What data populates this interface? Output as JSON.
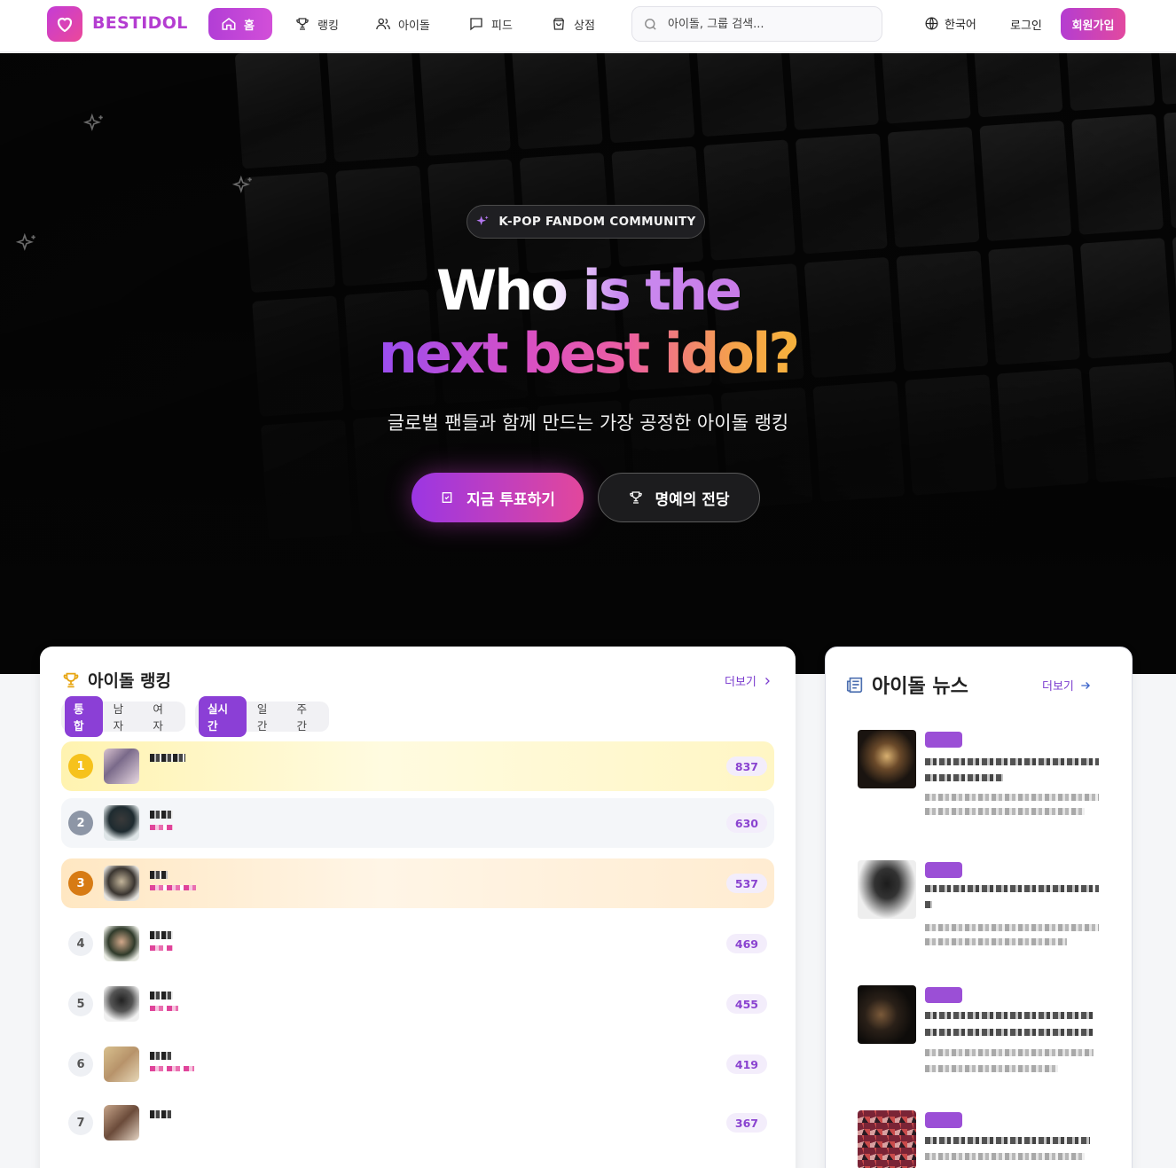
{
  "app": {
    "logo_text": "BESTIDOL",
    "brand_color": "#b43dd1"
  },
  "nav": {
    "items": [
      {
        "label": "홈",
        "icon": "home-icon",
        "active": true
      },
      {
        "label": "랭킹",
        "icon": "trophy-icon",
        "active": false
      },
      {
        "label": "아이돌",
        "icon": "users-icon",
        "active": false
      },
      {
        "label": "피드",
        "icon": "chat-icon",
        "active": false
      },
      {
        "label": "상점",
        "icon": "shopping-bag-icon",
        "active": false
      }
    ],
    "search_placeholder": "아이돌, 그룹 검색...",
    "language": "한국어",
    "login": "로그인",
    "signup": "회원가입"
  },
  "hero": {
    "badge": "K-POP FANDOM COMMUNITY",
    "headline_line1": "Who is the",
    "headline_line2": "next best idol?",
    "subtitle": "글로벌 팬들과 함께 만드는 가장 공정한 아이돌 랭킹",
    "primary_cta": "지금 투표하기",
    "secondary_cta": "명예의 전당"
  },
  "ranking": {
    "title": "아이돌 랭킹",
    "more": "더보기",
    "gender_filters": [
      "통합",
      "남자",
      "여자"
    ],
    "gender_selected": "통합",
    "period_filters": [
      "실시간",
      "일간",
      "주간"
    ],
    "period_selected": "실시간",
    "rows": [
      {
        "rank": "1",
        "score": "837"
      },
      {
        "rank": "2",
        "score": "630"
      },
      {
        "rank": "3",
        "score": "537"
      },
      {
        "rank": "4",
        "score": "469"
      },
      {
        "rank": "5",
        "score": "455"
      },
      {
        "rank": "6",
        "score": "419"
      },
      {
        "rank": "7",
        "score": "367"
      }
    ]
  },
  "news": {
    "title": "아이돌 뉴스",
    "more": "더보기"
  },
  "colors": {
    "gold": "#f6c21c",
    "silver": "#8d96a6",
    "bronze": "#d77b14",
    "accent_purple": "#8b3fd6"
  }
}
